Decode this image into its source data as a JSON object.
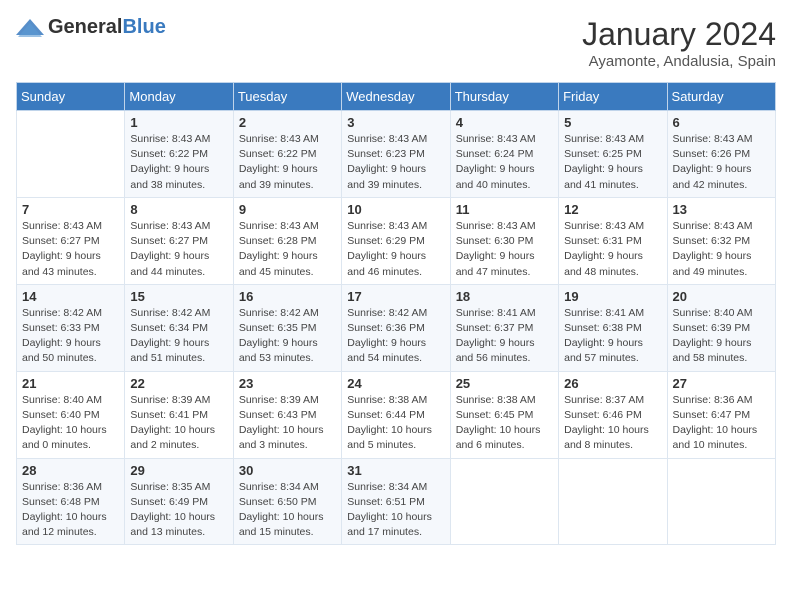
{
  "logo": {
    "general": "General",
    "blue": "Blue"
  },
  "title": {
    "month_year": "January 2024",
    "location": "Ayamonte, Andalusia, Spain"
  },
  "days_of_week": [
    "Sunday",
    "Monday",
    "Tuesday",
    "Wednesday",
    "Thursday",
    "Friday",
    "Saturday"
  ],
  "weeks": [
    [
      {
        "day": "",
        "sunrise": "",
        "sunset": "",
        "daylight": ""
      },
      {
        "day": "1",
        "sunrise": "Sunrise: 8:43 AM",
        "sunset": "Sunset: 6:22 PM",
        "daylight": "Daylight: 9 hours and 38 minutes."
      },
      {
        "day": "2",
        "sunrise": "Sunrise: 8:43 AM",
        "sunset": "Sunset: 6:22 PM",
        "daylight": "Daylight: 9 hours and 39 minutes."
      },
      {
        "day": "3",
        "sunrise": "Sunrise: 8:43 AM",
        "sunset": "Sunset: 6:23 PM",
        "daylight": "Daylight: 9 hours and 39 minutes."
      },
      {
        "day": "4",
        "sunrise": "Sunrise: 8:43 AM",
        "sunset": "Sunset: 6:24 PM",
        "daylight": "Daylight: 9 hours and 40 minutes."
      },
      {
        "day": "5",
        "sunrise": "Sunrise: 8:43 AM",
        "sunset": "Sunset: 6:25 PM",
        "daylight": "Daylight: 9 hours and 41 minutes."
      },
      {
        "day": "6",
        "sunrise": "Sunrise: 8:43 AM",
        "sunset": "Sunset: 6:26 PM",
        "daylight": "Daylight: 9 hours and 42 minutes."
      }
    ],
    [
      {
        "day": "7",
        "sunrise": "Sunrise: 8:43 AM",
        "sunset": "Sunset: 6:27 PM",
        "daylight": "Daylight: 9 hours and 43 minutes."
      },
      {
        "day": "8",
        "sunrise": "Sunrise: 8:43 AM",
        "sunset": "Sunset: 6:27 PM",
        "daylight": "Daylight: 9 hours and 44 minutes."
      },
      {
        "day": "9",
        "sunrise": "Sunrise: 8:43 AM",
        "sunset": "Sunset: 6:28 PM",
        "daylight": "Daylight: 9 hours and 45 minutes."
      },
      {
        "day": "10",
        "sunrise": "Sunrise: 8:43 AM",
        "sunset": "Sunset: 6:29 PM",
        "daylight": "Daylight: 9 hours and 46 minutes."
      },
      {
        "day": "11",
        "sunrise": "Sunrise: 8:43 AM",
        "sunset": "Sunset: 6:30 PM",
        "daylight": "Daylight: 9 hours and 47 minutes."
      },
      {
        "day": "12",
        "sunrise": "Sunrise: 8:43 AM",
        "sunset": "Sunset: 6:31 PM",
        "daylight": "Daylight: 9 hours and 48 minutes."
      },
      {
        "day": "13",
        "sunrise": "Sunrise: 8:43 AM",
        "sunset": "Sunset: 6:32 PM",
        "daylight": "Daylight: 9 hours and 49 minutes."
      }
    ],
    [
      {
        "day": "14",
        "sunrise": "Sunrise: 8:42 AM",
        "sunset": "Sunset: 6:33 PM",
        "daylight": "Daylight: 9 hours and 50 minutes."
      },
      {
        "day": "15",
        "sunrise": "Sunrise: 8:42 AM",
        "sunset": "Sunset: 6:34 PM",
        "daylight": "Daylight: 9 hours and 51 minutes."
      },
      {
        "day": "16",
        "sunrise": "Sunrise: 8:42 AM",
        "sunset": "Sunset: 6:35 PM",
        "daylight": "Daylight: 9 hours and 53 minutes."
      },
      {
        "day": "17",
        "sunrise": "Sunrise: 8:42 AM",
        "sunset": "Sunset: 6:36 PM",
        "daylight": "Daylight: 9 hours and 54 minutes."
      },
      {
        "day": "18",
        "sunrise": "Sunrise: 8:41 AM",
        "sunset": "Sunset: 6:37 PM",
        "daylight": "Daylight: 9 hours and 56 minutes."
      },
      {
        "day": "19",
        "sunrise": "Sunrise: 8:41 AM",
        "sunset": "Sunset: 6:38 PM",
        "daylight": "Daylight: 9 hours and 57 minutes."
      },
      {
        "day": "20",
        "sunrise": "Sunrise: 8:40 AM",
        "sunset": "Sunset: 6:39 PM",
        "daylight": "Daylight: 9 hours and 58 minutes."
      }
    ],
    [
      {
        "day": "21",
        "sunrise": "Sunrise: 8:40 AM",
        "sunset": "Sunset: 6:40 PM",
        "daylight": "Daylight: 10 hours and 0 minutes."
      },
      {
        "day": "22",
        "sunrise": "Sunrise: 8:39 AM",
        "sunset": "Sunset: 6:41 PM",
        "daylight": "Daylight: 10 hours and 2 minutes."
      },
      {
        "day": "23",
        "sunrise": "Sunrise: 8:39 AM",
        "sunset": "Sunset: 6:43 PM",
        "daylight": "Daylight: 10 hours and 3 minutes."
      },
      {
        "day": "24",
        "sunrise": "Sunrise: 8:38 AM",
        "sunset": "Sunset: 6:44 PM",
        "daylight": "Daylight: 10 hours and 5 minutes."
      },
      {
        "day": "25",
        "sunrise": "Sunrise: 8:38 AM",
        "sunset": "Sunset: 6:45 PM",
        "daylight": "Daylight: 10 hours and 6 minutes."
      },
      {
        "day": "26",
        "sunrise": "Sunrise: 8:37 AM",
        "sunset": "Sunset: 6:46 PM",
        "daylight": "Daylight: 10 hours and 8 minutes."
      },
      {
        "day": "27",
        "sunrise": "Sunrise: 8:36 AM",
        "sunset": "Sunset: 6:47 PM",
        "daylight": "Daylight: 10 hours and 10 minutes."
      }
    ],
    [
      {
        "day": "28",
        "sunrise": "Sunrise: 8:36 AM",
        "sunset": "Sunset: 6:48 PM",
        "daylight": "Daylight: 10 hours and 12 minutes."
      },
      {
        "day": "29",
        "sunrise": "Sunrise: 8:35 AM",
        "sunset": "Sunset: 6:49 PM",
        "daylight": "Daylight: 10 hours and 13 minutes."
      },
      {
        "day": "30",
        "sunrise": "Sunrise: 8:34 AM",
        "sunset": "Sunset: 6:50 PM",
        "daylight": "Daylight: 10 hours and 15 minutes."
      },
      {
        "day": "31",
        "sunrise": "Sunrise: 8:34 AM",
        "sunset": "Sunset: 6:51 PM",
        "daylight": "Daylight: 10 hours and 17 minutes."
      },
      {
        "day": "",
        "sunrise": "",
        "sunset": "",
        "daylight": ""
      },
      {
        "day": "",
        "sunrise": "",
        "sunset": "",
        "daylight": ""
      },
      {
        "day": "",
        "sunrise": "",
        "sunset": "",
        "daylight": ""
      }
    ]
  ]
}
